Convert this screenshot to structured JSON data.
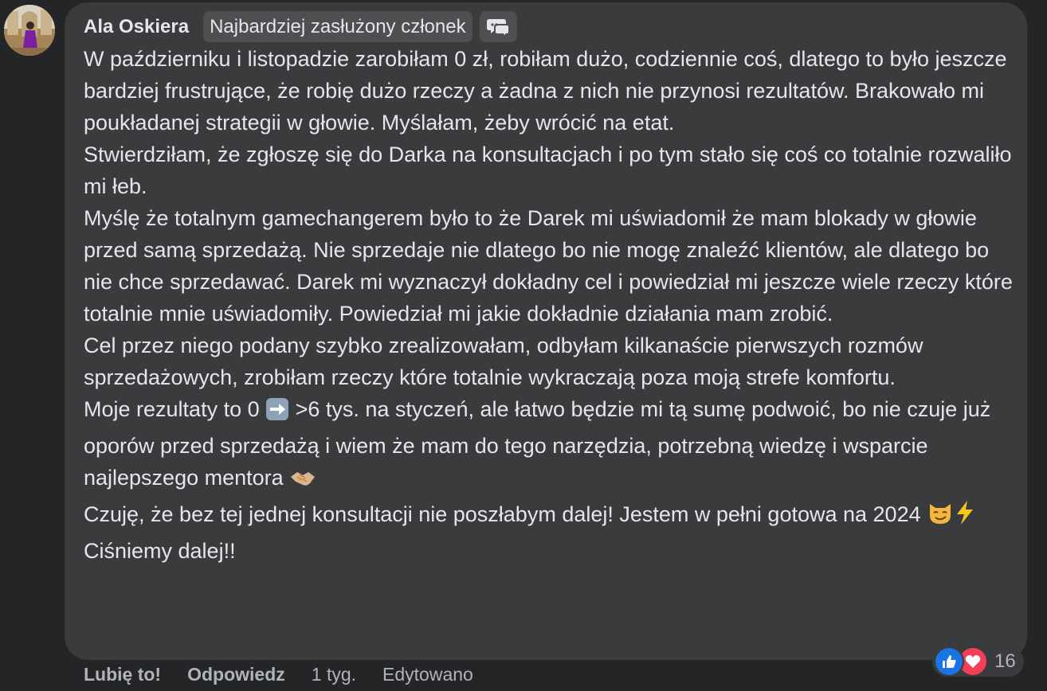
{
  "comment": {
    "author": "Ala Oskiera",
    "badge": "Najbardziej zasłużony członek",
    "paragraphs": [
      "W październiku i listopadzie zarobiłam 0 zł, robiłam dużo, codziennie coś, dlatego to było jeszcze bardziej frustrujące, że robię dużo rzeczy a żadna z nich nie przynosi rezultatów. Brakowało mi poukładanej strategii w głowie. Myślałam, żeby wrócić na etat.",
      "Stwierdziłam, że zgłoszę się do Darka na konsultacjach i po tym stało się coś co totalnie rozwaliło mi łeb.",
      "Myślę że totalnym gamechangerem było to że Darek mi uświadomił że mam blokady w głowie przed samą sprzedażą. Nie sprzedaje nie dlatego bo nie mogę znaleźć klientów, ale dlatego bo nie chce sprzedawać. Darek mi wyznaczył dokładny cel i powiedział mi jeszcze wiele rzeczy które totalnie mnie uświadomiły. Powiedział mi jakie dokładnie działania mam zrobić.",
      "Cel przez niego podany szybko zrealizowałam, odbyłam kilkanaście pierwszych rozmów sprzedażowych, zrobiłam rzeczy które totalnie wykraczają poza moją strefe komfortu."
    ],
    "p5_a": "Moje rezultaty to 0 ",
    "p5_b": " >6 tys. na styczeń, ale łatwo będzie mi tą sumę podwoić, bo nie czuje już oporów przed sprzedażą i wiem że mam do tego narzędzia, potrzebną wiedzę i wsparcie najlepszego mentora ",
    "p6_a": "Czuję, że bez tej jednej konsultacji nie poszłabym dalej! Jestem w pełni gotowa na 2024 ",
    "p6_b": " Ciśniemy dalej!!",
    "emojis": [
      "arrow-right-emoji",
      "handshake-emoji",
      "smirking-cat-emoji",
      "lightning-emoji"
    ]
  },
  "reactions": {
    "types": [
      "like-icon",
      "heart-icon"
    ],
    "count": "16",
    "colors": {
      "like": "#1b74e4",
      "love": "#f33e58"
    }
  },
  "actions": {
    "like": "Lubię to!",
    "reply": "Odpowiedz",
    "time": "1 tyg.",
    "edited": "Edytowano"
  },
  "colors": {
    "background": "#242526",
    "bubble": "#3a3b3c",
    "badge": "#4e4f50",
    "text": "#e4e6eb",
    "secondary_text": "#b0b3b8"
  }
}
